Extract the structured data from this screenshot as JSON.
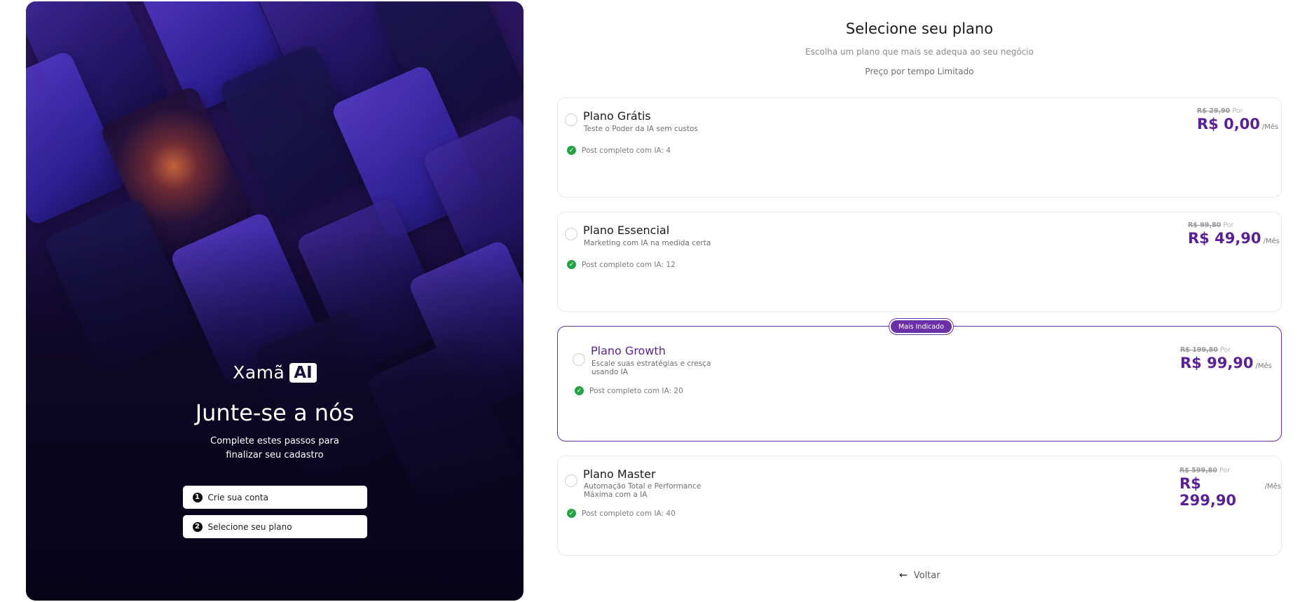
{
  "brand": {
    "name": "Xamã",
    "badge": "AI"
  },
  "join": {
    "title": "Junte-se a nós",
    "subtitle": "Complete estes passos para finalizar seu cadastro"
  },
  "steps": [
    {
      "number": "1",
      "label": "Crie sua conta"
    },
    {
      "number": "2",
      "label": "Selecione seu plano"
    }
  ],
  "header": {
    "title": "Selecione seu plano",
    "subtitle": "Escolha um plano que mais se adequa ao seu negócio",
    "note": "Preço por tempo Limitado"
  },
  "plans": [
    {
      "name": "Plano Grátis",
      "description": "Teste o Poder da IA sem custos",
      "feature": "Post completo com IA: 4",
      "old_price": "R$ 29,90",
      "por": "Por",
      "price": "R$ 0,00",
      "per": "/Mês"
    },
    {
      "name": "Plano Essencial",
      "description": "Marketing com IA na medida certa",
      "feature": "Post completo com IA: 12",
      "old_price": "R$ 99,80",
      "por": "Por",
      "price": "R$ 49,90",
      "per": "/Mês"
    },
    {
      "name": "Plano Growth",
      "description": "Escale suas estratégias e cresça usando IA",
      "feature": "Post completo com IA: 20",
      "old_price": "R$ 199,80",
      "por": "Por",
      "price": "R$ 99,90",
      "per": "/Mês",
      "badge": "Mais Indicado"
    },
    {
      "name": "Plano Master",
      "description": "Automação Total e Performance Máxima com a IA",
      "feature": "Post completo com IA: 40",
      "old_price": "R$ 599,80",
      "por": "Por",
      "price": "R$ 299,90",
      "per": "/Mês"
    }
  ],
  "back_label": "Voltar",
  "colors": {
    "accent": "#5b1f99",
    "check": "#22a444",
    "panel": "#1d1048"
  }
}
